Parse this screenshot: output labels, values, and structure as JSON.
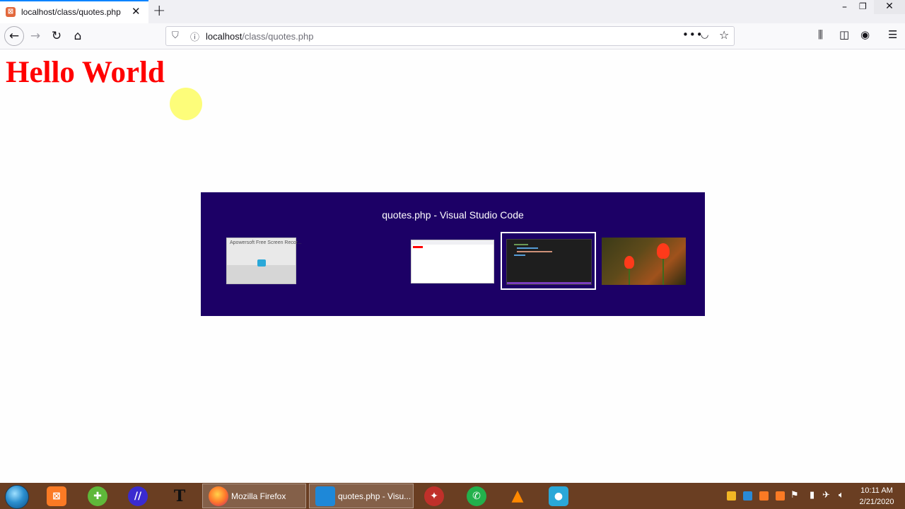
{
  "browser": {
    "tab": {
      "title": "localhost/class/quotes.php",
      "favicon": "xampp-icon"
    },
    "url": {
      "host": "localhost",
      "path": "/class/quotes.php"
    },
    "icons": [
      "back-icon",
      "forward-icon",
      "reload-icon",
      "home-icon",
      "shield-icon",
      "info-icon",
      "more-icon",
      "pocket-icon",
      "bookmark-star-icon",
      "library-icon",
      "sidebar-icon",
      "account-icon",
      "menu-icon"
    ]
  },
  "page": {
    "heading": "Hello World",
    "heading_color": "#ff0000"
  },
  "switcher": {
    "title": "quotes.php - Visual Studio Code",
    "background": "#1c0066",
    "windows": [
      {
        "label": "Apowersoft Free Screen Recor...",
        "app": "screen-recorder"
      },
      {
        "label": "",
        "app": "firefox"
      },
      {
        "label": "",
        "app": "vscode",
        "selected": true
      },
      {
        "label": "",
        "app": "desktop-wallpaper"
      }
    ]
  },
  "taskbar": {
    "background": "#6a3e22",
    "windows": [
      {
        "label": "Mozilla Firefox",
        "app": "firefox"
      },
      {
        "label": "quotes.php - Visu...",
        "app": "vscode"
      }
    ],
    "clock": {
      "time": "10:11 AM",
      "date": "2/21/2020"
    }
  }
}
